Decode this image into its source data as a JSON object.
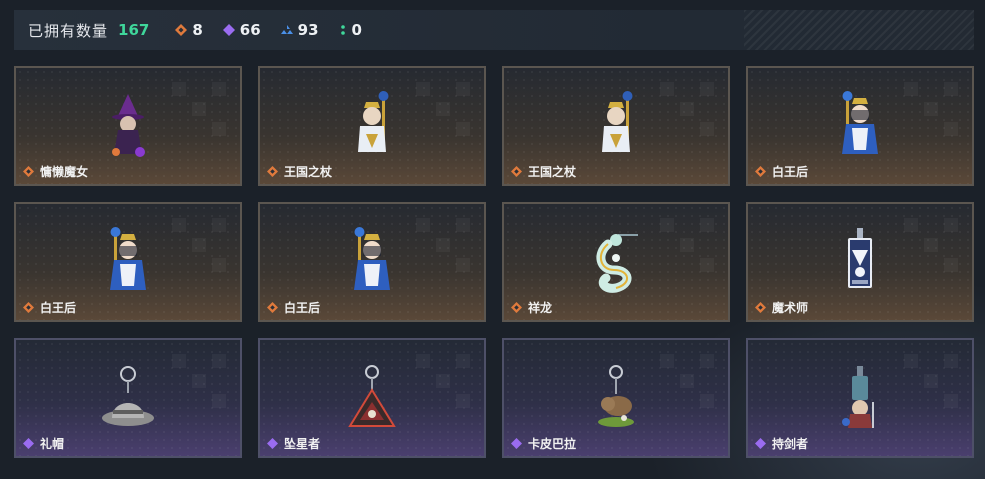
{
  "header": {
    "owned_label": "已拥有数量",
    "owned_count": "167",
    "stats": [
      {
        "icon": "orange-diamond-icon",
        "color": "#e07a3c",
        "value": "8"
      },
      {
        "icon": "purple-diamond-icon",
        "color": "#9a6cf0",
        "value": "66"
      },
      {
        "icon": "blue-diamond-icon",
        "color": "#4a90e8",
        "value": "93"
      },
      {
        "icon": "green-dots-icon",
        "color": "#3fd79b",
        "value": "0"
      }
    ]
  },
  "rarity_colors": {
    "orange": "#e07a3c",
    "purple": "#9a6cf0"
  },
  "items": [
    {
      "name": "慵懒魔女",
      "rarity": "orange",
      "icon": "witch-figure-icon"
    },
    {
      "name": "王国之杖",
      "rarity": "orange",
      "icon": "scepter-figure-icon"
    },
    {
      "name": "王国之杖",
      "rarity": "orange",
      "icon": "scepter-figure-icon"
    },
    {
      "name": "白王后",
      "rarity": "orange",
      "icon": "white-queen-figure-icon"
    },
    {
      "name": "白王后",
      "rarity": "orange",
      "icon": "white-queen-figure-icon"
    },
    {
      "name": "白王后",
      "rarity": "orange",
      "icon": "white-queen-figure-icon"
    },
    {
      "name": "祥龙",
      "rarity": "orange",
      "icon": "dragon-figure-icon"
    },
    {
      "name": "魔术师",
      "rarity": "orange",
      "icon": "magician-card-icon"
    },
    {
      "name": "礼帽",
      "rarity": "purple",
      "icon": "hat-keychain-icon"
    },
    {
      "name": "坠星者",
      "rarity": "purple",
      "icon": "triangle-keychain-icon"
    },
    {
      "name": "卡皮巴拉",
      "rarity": "purple",
      "icon": "capybara-keychain-icon"
    },
    {
      "name": "持剑者",
      "rarity": "purple",
      "icon": "swordsman-keychain-icon"
    }
  ]
}
